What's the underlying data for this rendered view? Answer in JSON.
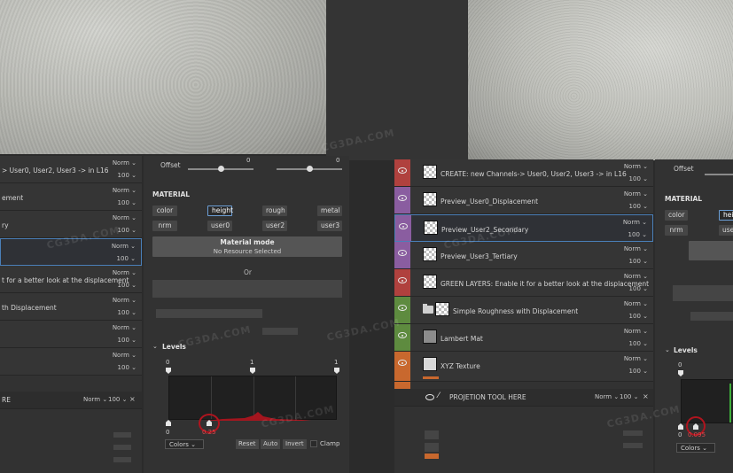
{
  "watermark": "CG3DA.COM",
  "left_layers": {
    "rows": [
      {
        "name": "> User0, User2, User3 -> in L16",
        "blend": "Norm ⌄",
        "opacity": "100 ⌄"
      },
      {
        "name": "ement",
        "blend": "Norm ⌄",
        "opacity": "100 ⌄"
      },
      {
        "name": "ry",
        "blend": "Norm ⌄",
        "opacity": "100 ⌄"
      },
      {
        "name": "",
        "blend": "Norm ⌄",
        "opacity": "100 ⌄"
      },
      {
        "name": "t for a better look at the displacement",
        "blend": "Norm ⌄",
        "opacity": "100 ⌄"
      },
      {
        "name": "th Displacement",
        "blend": "Norm ⌄",
        "opacity": "100 ⌄"
      },
      {
        "name": "",
        "blend": "Norm ⌄",
        "opacity": "100 ⌄"
      },
      {
        "name": "",
        "blend": "Norm ⌄",
        "opacity": "100 ⌄"
      }
    ],
    "tool": {
      "name": "RE",
      "blend": "Norm ⌄",
      "opacity": "100 ⌄",
      "close": "×"
    }
  },
  "right_layers": {
    "rows": [
      {
        "name": "CREATE: new Channels-> User0, User2, User3 -> in L16",
        "blend": "Norm ⌄",
        "opacity": "100 ⌄",
        "color": "#b0413e",
        "thumb": "checker"
      },
      {
        "name": "Preview_User0_Displacement",
        "blend": "Norm ⌄",
        "opacity": "100 ⌄",
        "color": "#8a5da0",
        "thumb": "checker"
      },
      {
        "name": "Preview_User2_Secondary",
        "blend": "Norm ⌄",
        "opacity": "100 ⌄",
        "color": "#8a5da0",
        "thumb": "checker"
      },
      {
        "name": "Preview_User3_Tertiary",
        "blend": "Norm ⌄",
        "opacity": "100 ⌄",
        "color": "#8a5da0",
        "thumb": "checker"
      },
      {
        "name": "GREEN LAYERS: Enable it for a better look at the displacement",
        "blend": "Norm ⌄",
        "opacity": "100 ⌄",
        "color": "#b0413e",
        "thumb": "checker"
      },
      {
        "name": "Simple Roughness with Displacement",
        "blend": "Norm ⌄",
        "opacity": "100 ⌄",
        "color": "#5e8b3f",
        "thumb": "checker"
      },
      {
        "name": "Lambert Mat",
        "blend": "Norm ⌄",
        "opacity": "100 ⌄",
        "color": "#5e8b3f",
        "thumb": "grey"
      },
      {
        "name": "XYZ Texture",
        "blend": "Norm ⌄",
        "opacity": "100 ⌄",
        "color": "#c8682e",
        "thumb": "xyz"
      }
    ],
    "tool": {
      "name": "PROJETION TOOL HERE",
      "blend": "Norm ⌄",
      "opacity": "100 ⌄",
      "close": "×"
    }
  },
  "props_left": {
    "offset_label": "Offset",
    "offset_value_1": "0",
    "offset_value_2": "0",
    "material_title": "MATERIAL",
    "channels": [
      "color",
      "height",
      "rough",
      "metal",
      "nrm",
      "user0",
      "user2",
      "user3"
    ],
    "material_mode_title": "Material mode",
    "material_mode_sub": "No Resource Selected",
    "or_text": "Or",
    "levels_title": "Levels",
    "levels_top": [
      "0",
      "1",
      "1"
    ],
    "levels_bottom_left": "0",
    "levels_value": "0.25",
    "colors_select": "Colors",
    "reset": "Reset",
    "auto": "Auto",
    "invert": "Invert",
    "clamp": "Clamp"
  },
  "props_right": {
    "offset_label": "Offset",
    "material_title": "MATERIAL",
    "channels": [
      "color",
      "heig",
      "nrm",
      "use"
    ],
    "levels_title": "Levels",
    "levels_top": "0",
    "levels_bottom_left": "0",
    "levels_value": "0.095",
    "colors_select": "Colors"
  }
}
